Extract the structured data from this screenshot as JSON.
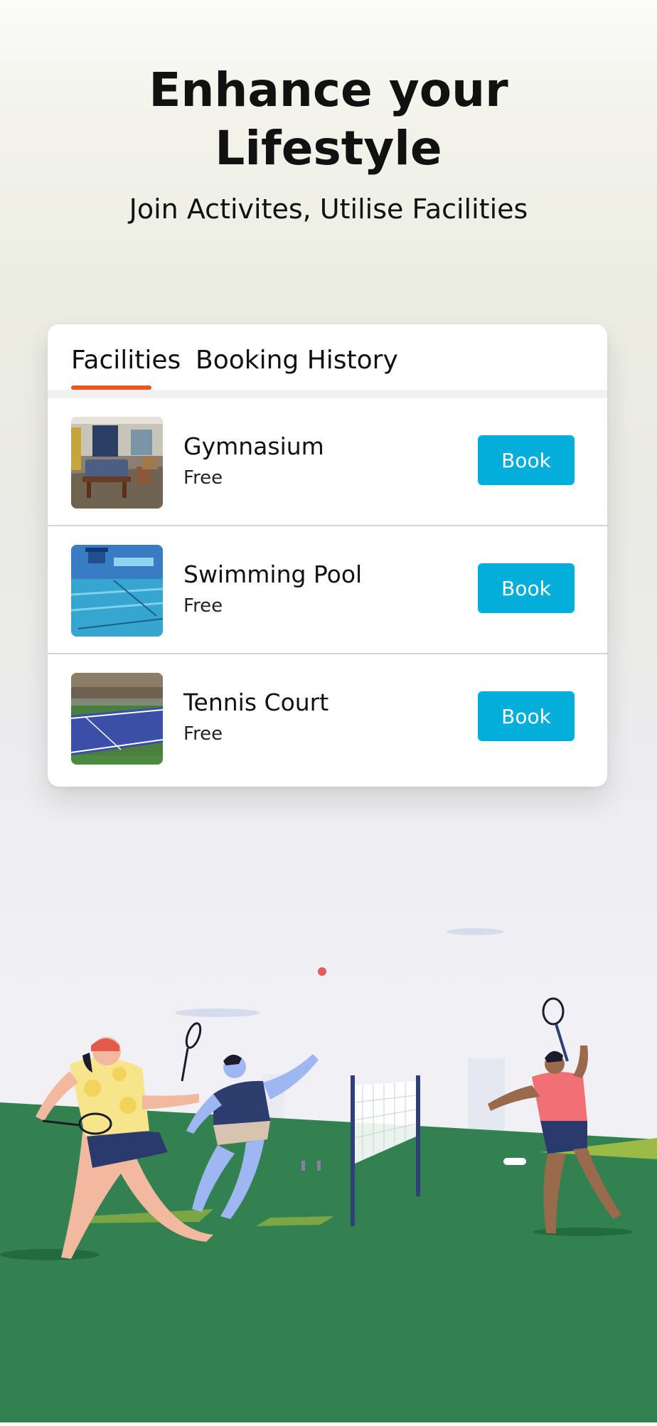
{
  "hero": {
    "title_line1": "Enhance your",
    "title_line2": "Lifestyle",
    "subtitle": "Join Activites, Utilise Facilities"
  },
  "tabs": [
    {
      "label": "Facilities",
      "active": true
    },
    {
      "label": "Booking History",
      "active": false
    }
  ],
  "facilities": [
    {
      "name": "Gymnasium",
      "price": "Free",
      "action": "Book",
      "icon": "gym-room-photo"
    },
    {
      "name": "Swimming Pool",
      "price": "Free",
      "action": "Book",
      "icon": "pool-photo"
    },
    {
      "name": "Tennis Court",
      "price": "Free",
      "action": "Book",
      "icon": "tennis-court-photo"
    }
  ],
  "colors": {
    "accent": "#e8571f",
    "button": "#04aedb",
    "grass": "#338050"
  },
  "illustration": "badminton-players-illustration"
}
